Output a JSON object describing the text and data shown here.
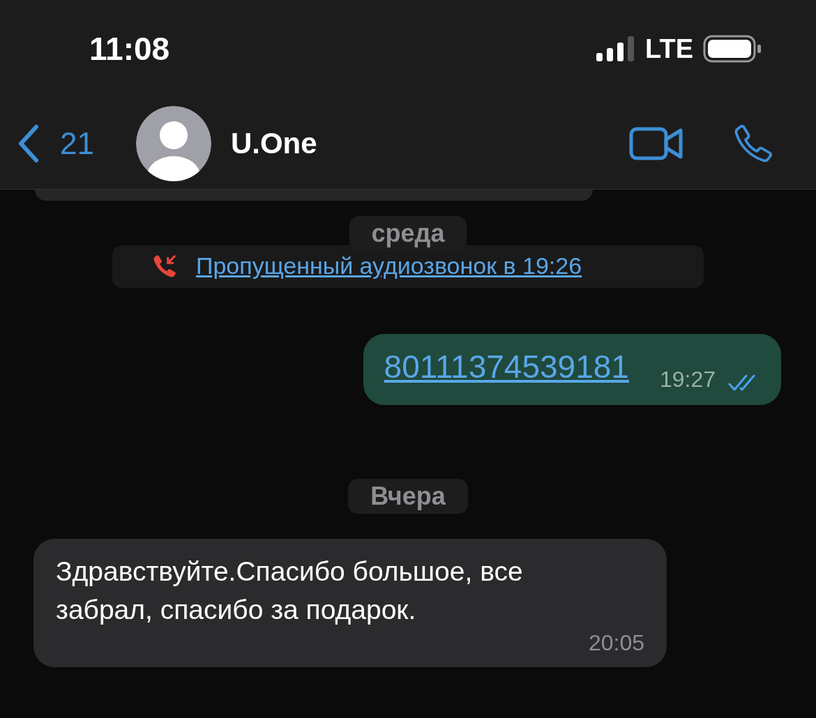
{
  "status_bar": {
    "time": "11:08",
    "network": "LTE"
  },
  "header": {
    "back_count": "21",
    "contact_name": "U.One"
  },
  "messages": [
    {
      "kind": "partial"
    },
    {
      "kind": "date",
      "text": "среда"
    },
    {
      "kind": "missed_call",
      "text": "Пропущенный аудиозвонок в 19:26"
    },
    {
      "kind": "outgoing",
      "text": "80111374539181",
      "time": "19:27",
      "read": true
    },
    {
      "kind": "date",
      "text": "Вчера"
    },
    {
      "kind": "incoming",
      "text": "Здравствуйте.Спасибо большое, все забрал, спасибо за подарок.",
      "time": "20:05"
    }
  ]
}
